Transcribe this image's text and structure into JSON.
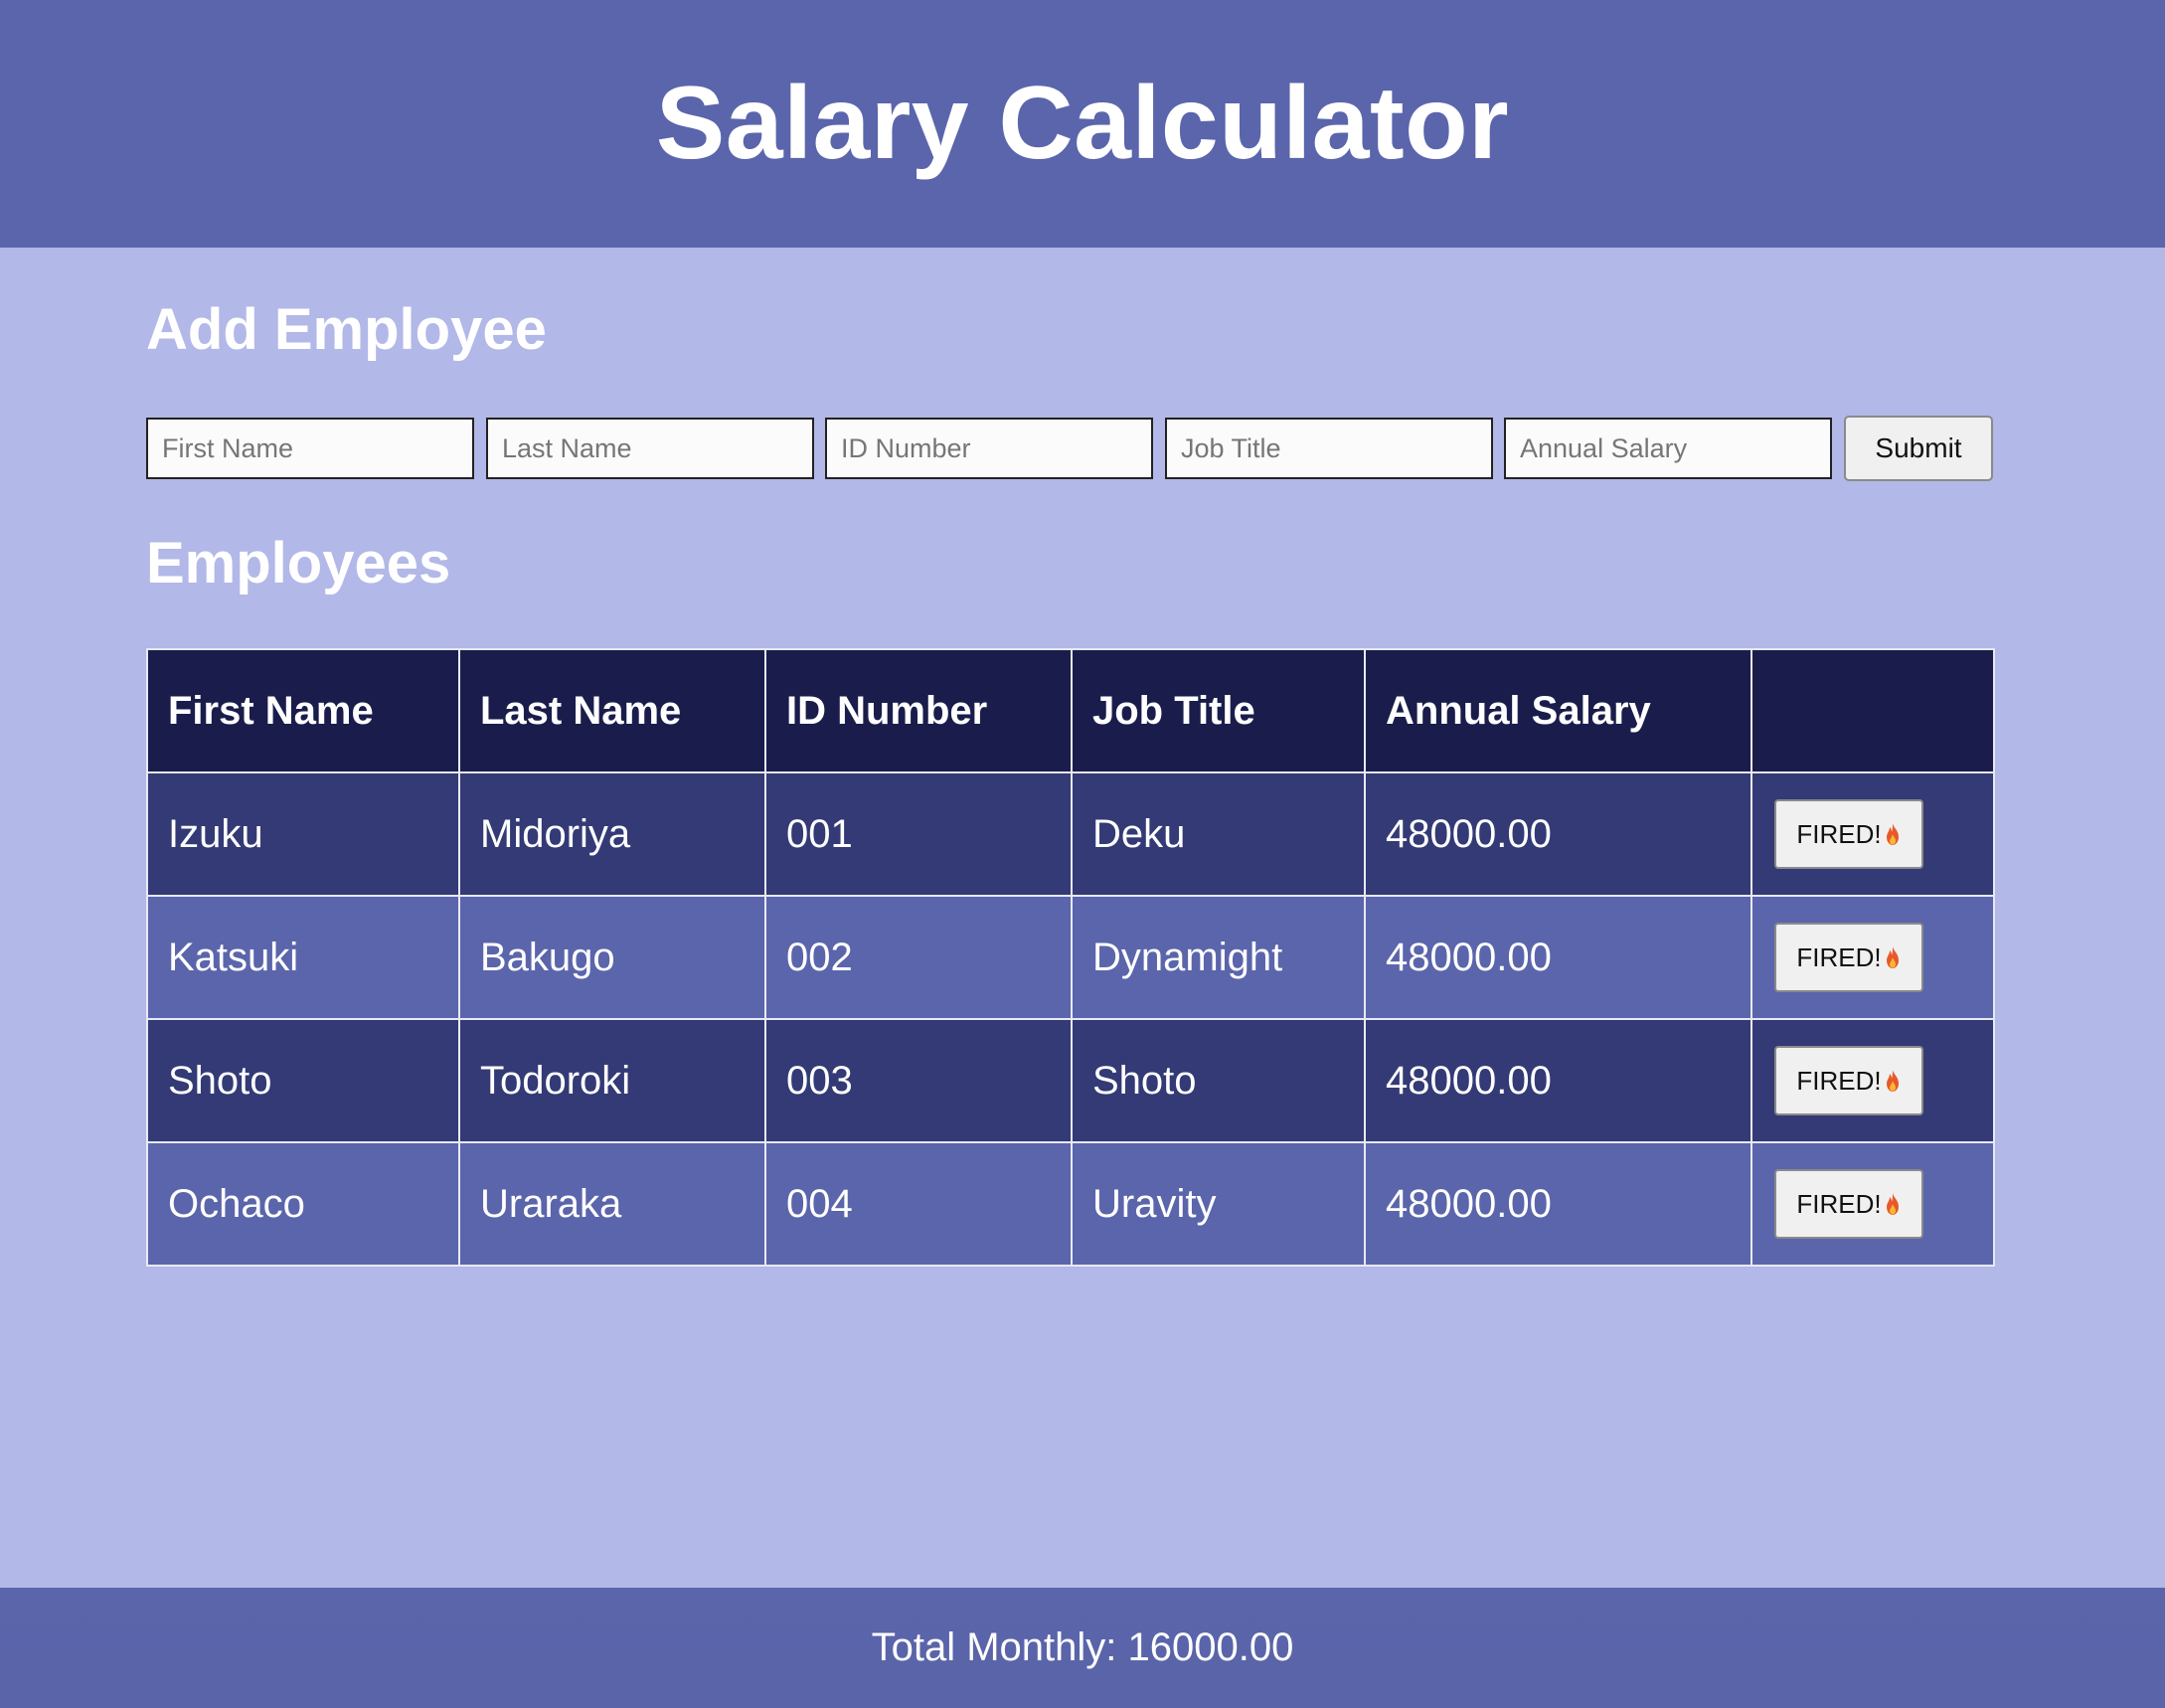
{
  "header": {
    "title": "Salary Calculator"
  },
  "add_section": {
    "title": "Add Employee",
    "fields": {
      "first_name": {
        "placeholder": "First Name",
        "value": ""
      },
      "last_name": {
        "placeholder": "Last Name",
        "value": ""
      },
      "id_number": {
        "placeholder": "ID Number",
        "value": ""
      },
      "job_title": {
        "placeholder": "Job Title",
        "value": ""
      },
      "annual_salary": {
        "placeholder": "Annual Salary",
        "value": ""
      }
    },
    "submit_label": "Submit"
  },
  "employees_section": {
    "title": "Employees",
    "columns": [
      "First Name",
      "Last Name",
      "ID Number",
      "Job Title",
      "Annual Salary",
      ""
    ],
    "rows": [
      {
        "first": "Izuku",
        "last": "Midoriya",
        "id": "001",
        "title": "Deku",
        "salary": "48000.00",
        "action": "FIRED!"
      },
      {
        "first": "Katsuki",
        "last": "Bakugo",
        "id": "002",
        "title": "Dynamight",
        "salary": "48000.00",
        "action": "FIRED!"
      },
      {
        "first": "Shoto",
        "last": "Todoroki",
        "id": "003",
        "title": "Shoto",
        "salary": "48000.00",
        "action": "FIRED!"
      },
      {
        "first": "Ochaco",
        "last": "Uraraka",
        "id": "004",
        "title": "Uravity",
        "salary": "48000.00",
        "action": "FIRED!"
      }
    ],
    "action_icon": "flame-icon"
  },
  "footer": {
    "total_monthly": "Total Monthly: 16000.00"
  },
  "colors": {
    "header_bg": "#5b65ab",
    "page_bg": "#b2b8e7",
    "table_header_bg": "#1a1d4b",
    "row_dark": "#333a75",
    "row_light": "#5b65ab"
  }
}
